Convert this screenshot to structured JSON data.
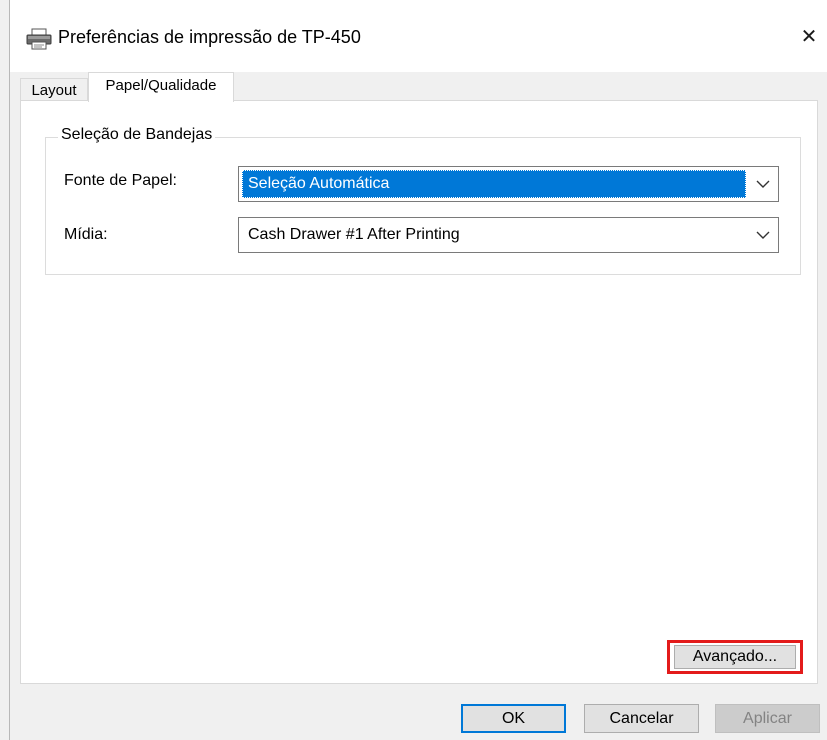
{
  "window": {
    "title": "Preferências de impressão de TP-450",
    "close_glyph": "✕",
    "icon": "printer-icon"
  },
  "tabs": [
    {
      "label": "Layout",
      "active": false
    },
    {
      "label": "Papel/Qualidade",
      "active": true
    }
  ],
  "tray_group": {
    "title": "Seleção de Bandejas",
    "paper_source": {
      "label": "Fonte de Papel:",
      "value": "Seleção Automática"
    },
    "media": {
      "label": "Mídia:",
      "value": "Cash Drawer #1 After Printing"
    }
  },
  "advanced_button": {
    "label": "Avançado...",
    "highlight_color": "#e31b1b"
  },
  "footer": {
    "ok_label": "OK",
    "cancel_label": "Cancelar",
    "apply_label": "Aplicar",
    "apply_enabled": false
  },
  "colors": {
    "selection": "#0078d7",
    "default_button_border": "#0078d7"
  }
}
